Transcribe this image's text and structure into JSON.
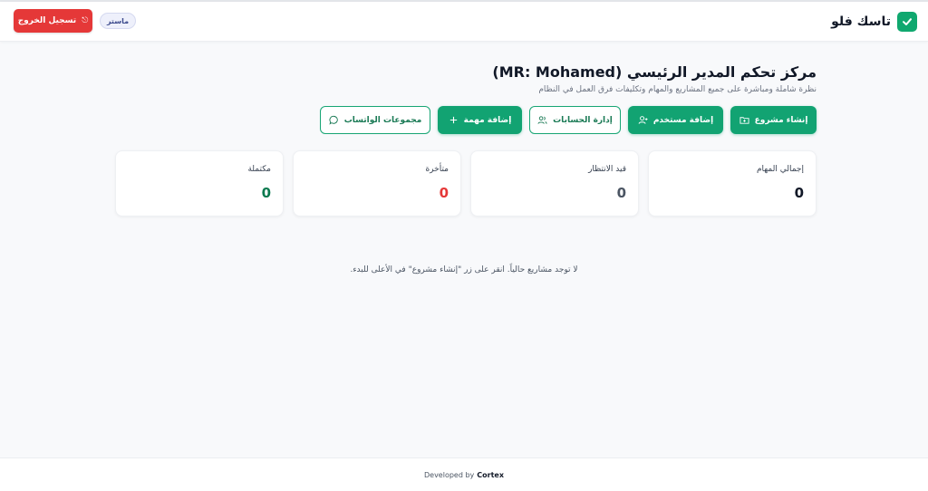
{
  "app": {
    "name": "تاسك فلو"
  },
  "header": {
    "role_badge": "ماستر",
    "logout_label": "تسجيل الخروج",
    "logout_icon": "logout-icon"
  },
  "dashboard": {
    "title": "مركز تحكم المدير الرئيسي (MR: Mohamed)",
    "subtitle": "نظرة شاملة ومباشرة على جميع المشاريع والمهام وتكليفات فرق العمل في النظام"
  },
  "actions": [
    {
      "label": "إنشاء مشروع",
      "icon": "folder-plus-icon",
      "style": "primary"
    },
    {
      "label": "إضافة مستخدم",
      "icon": "user-plus-icon",
      "style": "primary"
    },
    {
      "label": "إدارة الحسابات",
      "icon": "users-icon",
      "style": "outline"
    },
    {
      "label": "إضافة مهمة",
      "icon": "plus-icon",
      "style": "primary"
    },
    {
      "label": "مجموعات الواتساب",
      "icon": "chat-bubble-icon",
      "style": "outline"
    }
  ],
  "stats": [
    {
      "label": "إجمالي المهام",
      "value": "0",
      "color": "#111827"
    },
    {
      "label": "قيد الانتظار",
      "value": "0",
      "color": "#4b5563"
    },
    {
      "label": "متأخرة",
      "value": "0",
      "color": "#e53838"
    },
    {
      "label": "مكتملة",
      "value": "0",
      "color": "#0b7a4f"
    }
  ],
  "empty_state": "لا توجد مشاريع حالياً. انقر على زر \"إنشاء مشروع\" في الأعلى للبدء.",
  "footer": {
    "prefix": "Developed by",
    "brand": "Cortex"
  },
  "colors": {
    "accent": "#12a372",
    "danger": "#e53838"
  }
}
